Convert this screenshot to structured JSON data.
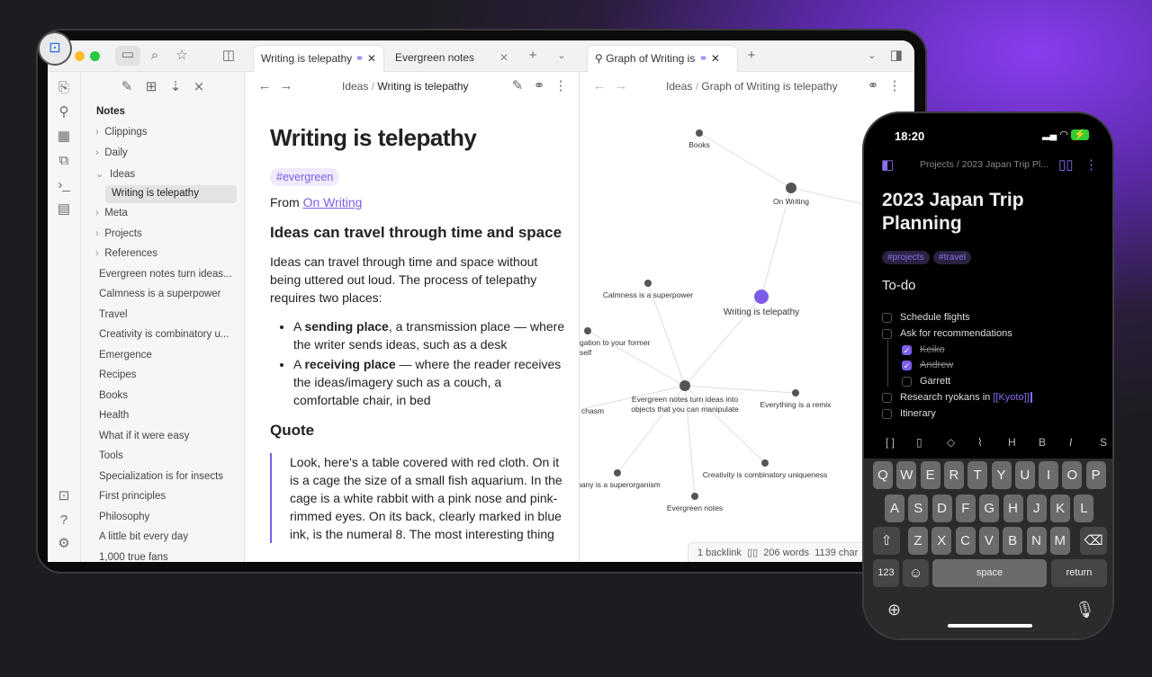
{
  "tablet": {
    "tabs": [
      {
        "label": "Writing is telepathy",
        "active": true
      },
      {
        "label": "Evergreen notes"
      },
      {
        "label": "Graph of Writing is telepathy",
        "active": true
      }
    ],
    "sidebar": {
      "section": "Notes",
      "folders": [
        "Clippings",
        "Daily",
        "Ideas",
        "Meta",
        "Projects",
        "References"
      ],
      "active_note": "Writing is telepathy",
      "notes": [
        "Evergreen notes turn ideas...",
        "Calmness is a superpower",
        "Travel",
        "Creativity is combinatory u...",
        "Emergence",
        "Recipes",
        "Books",
        "Health",
        "What if it were easy",
        "Tools",
        "Specialization is for insects",
        "First principles",
        "Philosophy",
        "A little bit every day",
        "1,000 true fans"
      ]
    },
    "editor": {
      "breadcrumb_parent": "Ideas",
      "breadcrumb_sep": "/",
      "breadcrumb_current": "Writing is telepathy",
      "title": "Writing is telepathy",
      "tag": "#evergreen",
      "from_label": "From",
      "from_link": "On Writing",
      "h2": "Ideas can travel through time and space",
      "para": "Ideas can travel through time and space without being uttered out loud. The process of telepathy requires two places:",
      "bullets": [
        {
          "pre": "A ",
          "bold": "sending place",
          "post": ", a transmission place — where the writer sends ideas, such as a desk"
        },
        {
          "pre": "A ",
          "bold": "receiving place",
          "post": " — where the reader receives the ideas/imagery such as a couch, a comfortable chair, in bed"
        }
      ],
      "h2b": "Quote",
      "quote": "Look, here's a table covered with red cloth. On it is a cage the size of a small fish aquarium. In the cage is a white rabbit with a pink nose and pink-rimmed eyes. On its back, clearly marked in blue ink, is the numeral 8. The most interesting thing"
    },
    "graph": {
      "breadcrumb_parent": "Ideas",
      "breadcrumb_sep": "/",
      "breadcrumb_current": "Graph of Writing is telepathy",
      "nodes": [
        "Books",
        "On Writing",
        "Writing is telepathy",
        "Calmness is a superpower",
        "gation to your former self",
        "Evergreen notes turn ideas into objects that you can manipulate",
        "Everything is a remix",
        "chasm",
        "mpany is a superorganism",
        "Evergreen notes",
        "Creativity is combinatory uniqueness"
      ],
      "status": {
        "backlinks": "1 backlink",
        "words": "206 words",
        "chars": "1139 char"
      }
    },
    "accent": "#7c5ce8"
  },
  "phone": {
    "time": "18:20",
    "breadcrumb": "Projects / 2023 Japan Trip Pl...",
    "title": "2023 Japan Trip Planning",
    "tags": [
      "#projects",
      "#travel"
    ],
    "heading": "To-do",
    "todos": [
      {
        "text": "Schedule flights",
        "done": false,
        "level": 0
      },
      {
        "text": "Ask for recommendations",
        "done": false,
        "level": 0
      },
      {
        "text": "Keiko",
        "done": true,
        "level": 1
      },
      {
        "text": "Andrew",
        "done": true,
        "level": 1
      },
      {
        "text": "Garrett",
        "done": false,
        "level": 1
      },
      {
        "text": "Research ryokans in ",
        "link": "[[Kyoto]]",
        "done": false,
        "level": 0
      },
      {
        "text": "Itinerary",
        "done": false,
        "level": 0
      }
    ],
    "toolbar": [
      "[ ]",
      "▯",
      "◇",
      "⌇",
      "H",
      "B",
      "I",
      "S"
    ],
    "keys": {
      "row1": [
        "Q",
        "W",
        "E",
        "R",
        "T",
        "Y",
        "U",
        "I",
        "O",
        "P"
      ],
      "row2": [
        "A",
        "S",
        "D",
        "F",
        "G",
        "H",
        "J",
        "K",
        "L"
      ],
      "row3": [
        "Z",
        "X",
        "C",
        "V",
        "B",
        "N",
        "M"
      ],
      "num": "123",
      "space": "space",
      "return": "return"
    }
  }
}
